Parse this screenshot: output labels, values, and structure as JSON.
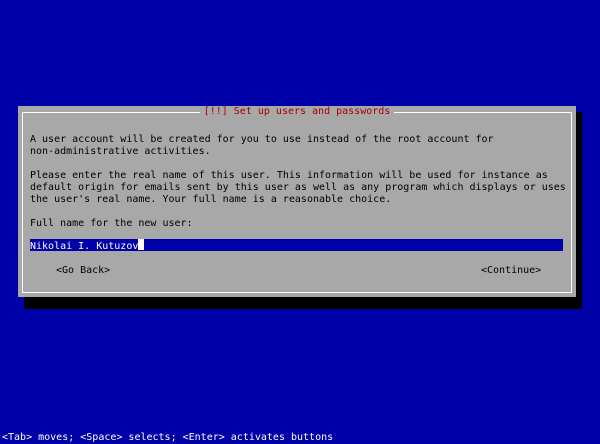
{
  "dialog": {
    "title": "[!!] Set up users and passwords",
    "paragraph1_line1": "A user account will be created for you to use instead of the root account for",
    "paragraph1_line2": "non-administrative activities.",
    "paragraph2_line1": "Please enter the real name of this user. This information will be used for instance as",
    "paragraph2_line2": "default origin for emails sent by this user as well as any program which displays or uses",
    "paragraph2_line3": "the user's real name. Your full name is a reasonable choice.",
    "field_label": "Full name for the new user:",
    "field_value": "Nikolai I. Kutuzov",
    "go_back_label": "<Go Back>",
    "continue_label": "<Continue>"
  },
  "footer": {
    "hint": "<Tab> moves; <Space> selects; <Enter> activates buttons"
  },
  "colors": {
    "background": "#0000a8",
    "dialog": "#a8a8a8",
    "title": "#a80000",
    "input_bg": "#0000a8",
    "text": "#000000",
    "hint_text": "#ffffff"
  }
}
